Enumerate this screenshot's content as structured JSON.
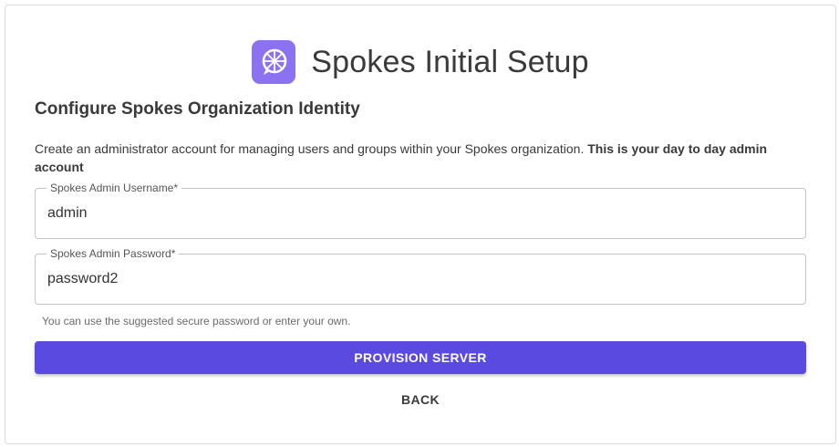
{
  "app": {
    "title": "Spokes Initial Setup",
    "logo_icon": "spoked-wheel-chat-icon"
  },
  "section": {
    "title": "Configure Spokes Organization Identity",
    "description": "Create an administrator account for managing users and groups within your Spokes organization.",
    "description_bold": "This is your day to day admin account"
  },
  "form": {
    "username": {
      "label": "Spokes Admin Username*",
      "value": "admin"
    },
    "password": {
      "label": "Spokes Admin Password*",
      "value": "password2",
      "helper": "You can use the suggested secure password or enter your own."
    }
  },
  "actions": {
    "provision_label": "PROVISION SERVER",
    "back_label": "BACK"
  },
  "colors": {
    "accent": "#5b4ae0",
    "logo_bg": "#8b72f0"
  }
}
